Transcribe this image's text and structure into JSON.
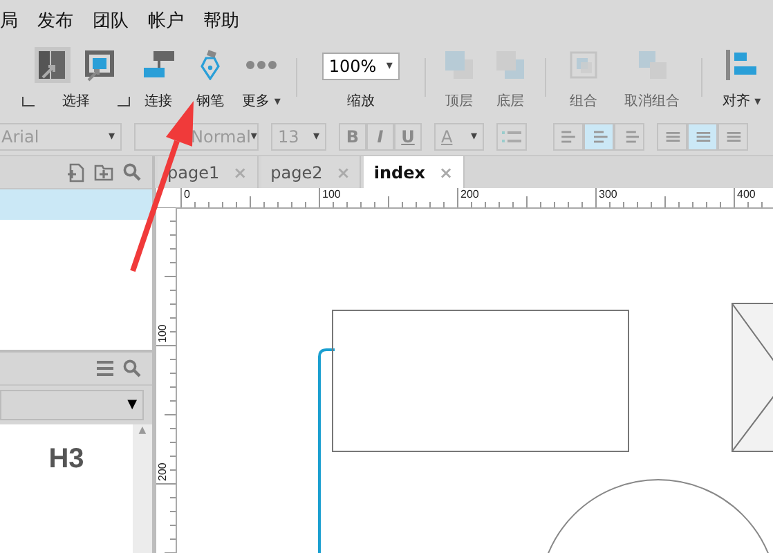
{
  "menu": [
    {
      "label": "局"
    },
    {
      "label": "发布"
    },
    {
      "label": "团队"
    },
    {
      "label": "帐户"
    },
    {
      "label": "帮助"
    }
  ],
  "toolbar": [
    {
      "kind": "select",
      "label": "选择",
      "selected": true,
      "disabled": false
    },
    {
      "kind": "connect",
      "label": "连接",
      "selected": false,
      "disabled": false
    },
    {
      "kind": "pen",
      "label": "钢笔",
      "selected": false,
      "disabled": false
    },
    {
      "kind": "more",
      "label": "更多",
      "caret": "▾",
      "selected": false,
      "disabled": false
    },
    {
      "kind": "zoom",
      "value": "100%",
      "value_caret": "▾",
      "label": "缩放",
      "disabled": false
    },
    {
      "kind": "front",
      "label": "顶层",
      "selected": false,
      "disabled": true
    },
    {
      "kind": "back",
      "label": "底层",
      "selected": false,
      "disabled": true
    },
    {
      "kind": "group",
      "label": "组合",
      "selected": false,
      "disabled": true
    },
    {
      "kind": "ungroup",
      "label": "取消组合",
      "selected": false,
      "disabled": true
    },
    {
      "kind": "align",
      "label": "对齐",
      "caret": "▾",
      "selected": false,
      "disabled": false
    }
  ],
  "format": {
    "font": "Arial",
    "style": "Normal",
    "size": "13",
    "dropdown_caret": "▾",
    "text_buttons": [
      "B",
      "I",
      "U"
    ],
    "font_color_label": "A",
    "halign": [
      {
        "selected": false
      },
      {
        "selected": true
      },
      {
        "selected": false
      }
    ],
    "valign": [
      {
        "selected": false
      },
      {
        "selected": true
      },
      {
        "selected": false
      }
    ]
  },
  "pages_panel": {
    "rows": [
      {
        "selected": true
      }
    ]
  },
  "widgets_panel": {
    "dropdown_caret": "▼",
    "scroll_up": "▲",
    "heading": "H3"
  },
  "tabs": [
    {
      "label": "page1",
      "selected": false,
      "close": "×"
    },
    {
      "label": "page2",
      "selected": false,
      "close": "×"
    },
    {
      "label": "index",
      "selected": true,
      "close": "×"
    }
  ],
  "ruler": {
    "x_labels": [
      "0",
      "100",
      "200",
      "300",
      "400"
    ],
    "y_labels": [
      "100",
      "200"
    ]
  }
}
